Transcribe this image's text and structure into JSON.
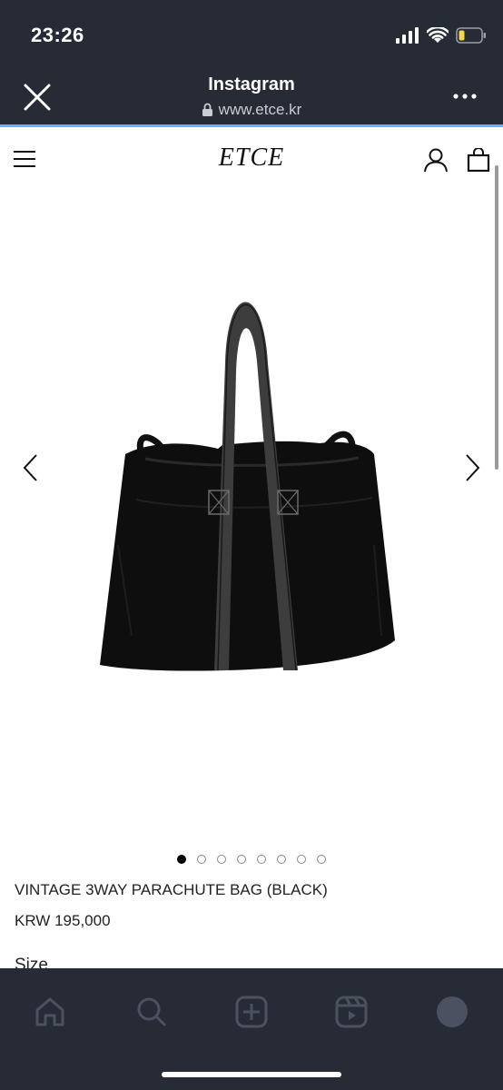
{
  "status_bar": {
    "time": "23:26"
  },
  "browser": {
    "title": "Instagram",
    "url": "www.etce.kr"
  },
  "site": {
    "logo": "ETCE"
  },
  "product": {
    "name": "VINTAGE 3WAY PARACHUTE BAG (BLACK)",
    "price": "KRW 195,000",
    "size_label": "Size",
    "carousel": {
      "total_slides": 8,
      "active_index": 0
    }
  },
  "colors": {
    "chrome_bg": "#262b35",
    "progress_bar": "#64b5f6",
    "page_bg": "#ffffff"
  },
  "icons": {
    "browser": [
      "close-icon",
      "lock-icon",
      "more-icon"
    ],
    "header": [
      "hamburger-menu-icon",
      "user-icon",
      "shopping-bag-icon"
    ],
    "tab_bar": [
      "home-icon",
      "search-icon",
      "create-icon",
      "reels-icon",
      "profile-icon"
    ]
  }
}
